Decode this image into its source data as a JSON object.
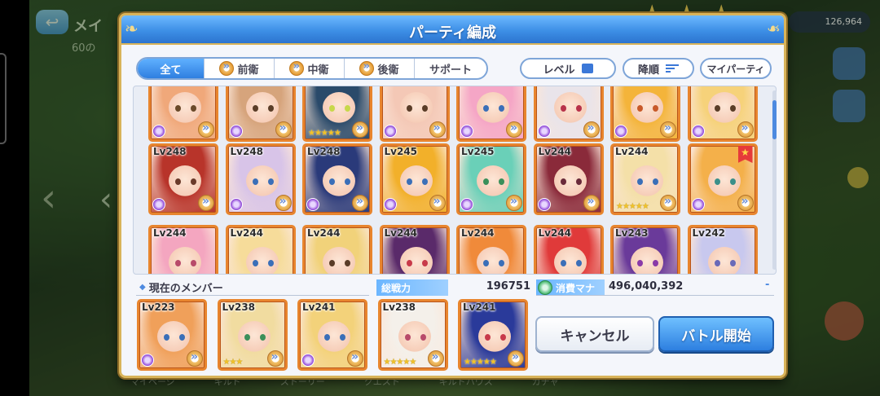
{
  "background": {
    "screen_title": "メイ",
    "sub_text": "60の",
    "top_currency": "126,964",
    "bottom_tabs": [
      "マイページ",
      "ギルド",
      "ストーリー",
      "クエスト",
      "ギルドハウス",
      "ガチャ"
    ]
  },
  "dialog": {
    "title": "パーティ編成",
    "filter_tabs": [
      {
        "label": "全て",
        "active": true,
        "has_icon": false
      },
      {
        "label": "前衛",
        "active": false,
        "has_icon": true
      },
      {
        "label": "中衛",
        "active": false,
        "has_icon": true
      },
      {
        "label": "後衛",
        "active": false,
        "has_icon": true
      },
      {
        "label": "サポート",
        "active": false,
        "has_icon": false
      }
    ],
    "sort": {
      "level_label": "レベル",
      "order_label": "降順",
      "my_party_label": "マイパーティ"
    },
    "grid_rows": [
      [
        {
          "lv": "",
          "stars": 0,
          "hair": "#f0a87a",
          "eye": "#6a4a2a"
        },
        {
          "lv": "",
          "stars": 0,
          "hair": "#d6a47c",
          "eye": "#5a3d28"
        },
        {
          "lv": "",
          "stars": 5,
          "hair": "#2a4a6a",
          "eye": "#c7d84a"
        },
        {
          "lv": "",
          "stars": 0,
          "hair": "#f4c8b6",
          "eye": "#5a3d28"
        },
        {
          "lv": "",
          "stars": 0,
          "hair": "#f5a6c6",
          "eye": "#3b6fb8"
        },
        {
          "lv": "",
          "stars": 0,
          "hair": "#e9e4ea",
          "eye": "#b8324a"
        },
        {
          "lv": "",
          "stars": 0,
          "hair": "#f4b43a",
          "eye": "#c85a2a"
        },
        {
          "lv": "",
          "stars": 0,
          "hair": "#f6d27a",
          "eye": "#5a3d28"
        }
      ],
      [
        {
          "lv": "Lv248",
          "stars": 0,
          "hair": "#b8342a",
          "eye": "#6a3a2a"
        },
        {
          "lv": "Lv248",
          "stars": 0,
          "hair": "#d8c4e8",
          "eye": "#3b6fb8"
        },
        {
          "lv": "Lv248",
          "stars": 0,
          "hair": "#2a3a7a",
          "eye": "#3b6fb8"
        },
        {
          "lv": "Lv245",
          "stars": 0,
          "hair": "#f2b02a",
          "eye": "#3b6fb8"
        },
        {
          "lv": "Lv245",
          "stars": 0,
          "hair": "#6ad0b8",
          "eye": "#3b8f5a"
        },
        {
          "lv": "Lv244",
          "stars": 0,
          "hair": "#8a2a3a",
          "eye": "#6a2a3a"
        },
        {
          "lv": "Lv244",
          "stars": 5,
          "hair": "#f4e0a8",
          "eye": "#3b6fb8"
        },
        {
          "lv": "",
          "stars": 0,
          "hair": "#f4b04a",
          "eye": "#3b8f8a",
          "fav": true
        }
      ],
      [
        {
          "lv": "Lv244",
          "stars": 0,
          "hair": "#f4a6c0",
          "eye": "#b84a6a"
        },
        {
          "lv": "Lv244",
          "stars": 0,
          "hair": "#f6dc9a",
          "eye": "#3b6fb8"
        },
        {
          "lv": "Lv244",
          "stars": 0,
          "hair": "#f1d27a",
          "eye": "#5a3d28"
        },
        {
          "lv": "Lv244",
          "stars": 0,
          "hair": "#5a2a6a",
          "eye": "#c83a4a"
        },
        {
          "lv": "Lv244",
          "stars": 0,
          "hair": "#f08a3a",
          "eye": "#3b6fb8"
        },
        {
          "lv": "Lv244",
          "stars": 0,
          "hair": "#e03a3a",
          "eye": "#3b6fb8"
        },
        {
          "lv": "Lv243",
          "stars": 0,
          "hair": "#6a3a9a",
          "eye": "#8a3aa8"
        },
        {
          "lv": "Lv242",
          "stars": 0,
          "hair": "#c8c8ee",
          "eye": "#6a6ab8"
        }
      ]
    ],
    "member_label": "現在のメンバー",
    "power_label": "総戦力",
    "power_value": "196751",
    "mana_label": "消費マナ",
    "mana_value": "496,040,392",
    "mana_dash": "-",
    "members": [
      {
        "lv": "Lv223",
        "stars": 0,
        "hair": "#f0a05a",
        "eye": "#3b6fb8"
      },
      {
        "lv": "Lv238",
        "stars": 3,
        "hair": "#f1dca0",
        "eye": "#3b8f5a"
      },
      {
        "lv": "Lv241",
        "stars": 0,
        "hair": "#f3d27a",
        "eye": "#3b6fb8"
      },
      {
        "lv": "Lv238",
        "stars": 5,
        "hair": "#f4f0ea",
        "eye": "#b84a6a"
      },
      {
        "lv": "Lv241",
        "stars": 5,
        "hair": "#2a3a9a",
        "eye": "#c83a4a"
      }
    ],
    "cancel_label": "キャンセル",
    "battle_label": "バトル開始"
  }
}
